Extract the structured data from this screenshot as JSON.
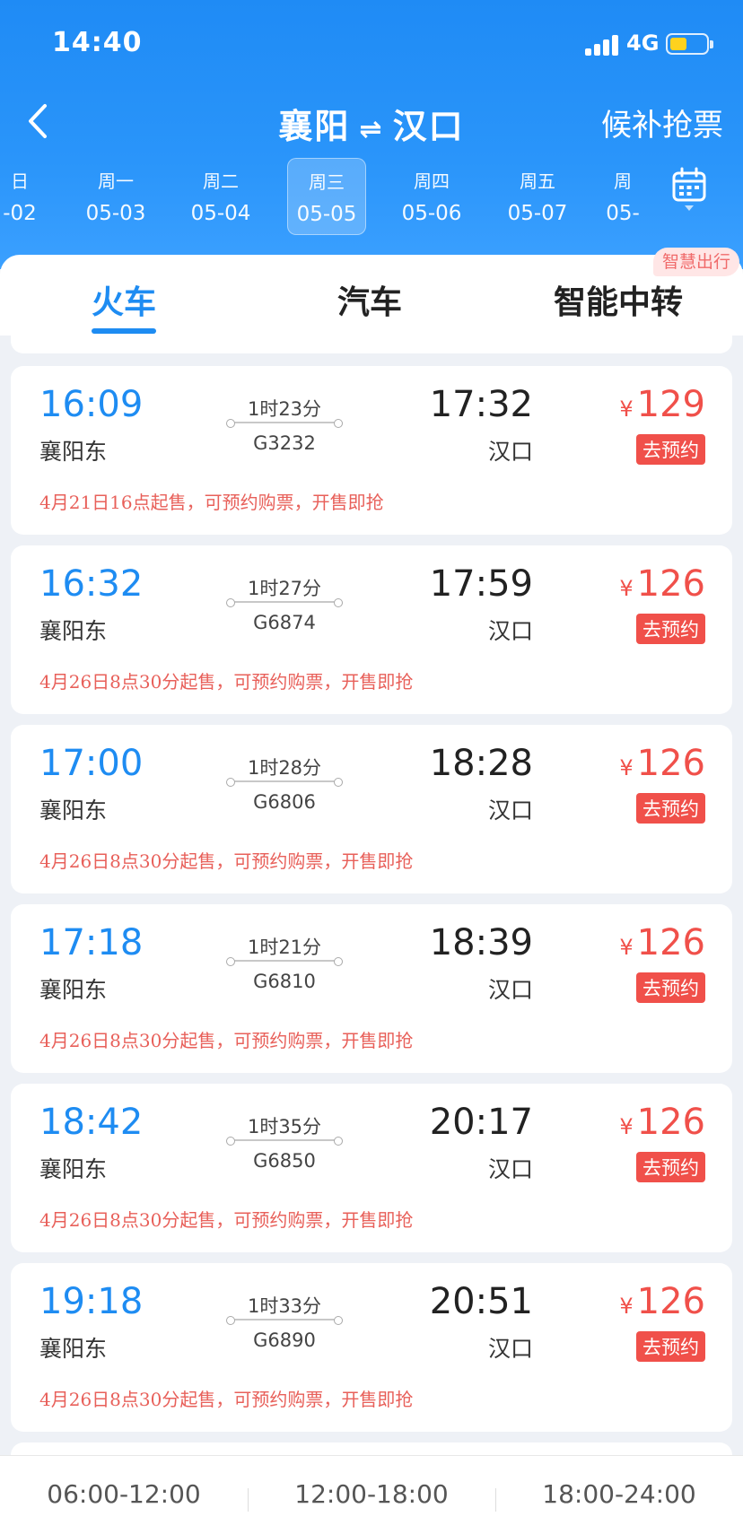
{
  "status_bar": {
    "time": "14:40",
    "network": "4G",
    "battery_fill": 0.45,
    "battery_color": "#ffd21e"
  },
  "nav": {
    "from": "襄阳",
    "swap_symbol": "⇌",
    "to": "汉口",
    "waitlist": "候补抢票"
  },
  "date_strip": [
    {
      "dow": "日",
      "md": "-02",
      "active": false
    },
    {
      "dow": "周一",
      "md": "05-03",
      "active": false
    },
    {
      "dow": "周二",
      "md": "05-04",
      "active": false
    },
    {
      "dow": "周三",
      "md": "05-05",
      "active": true
    },
    {
      "dow": "周四",
      "md": "05-06",
      "active": false
    },
    {
      "dow": "周五",
      "md": "05-07",
      "active": false
    },
    {
      "dow": "周",
      "md": "05-",
      "active": false
    }
  ],
  "mode_tabs": {
    "train": "火车",
    "bus": "汽车",
    "transfer": "智能中转",
    "badge": "智慧出行"
  },
  "trains": [
    {
      "dep_time": "16:09",
      "dep_station": "襄阳东",
      "duration": "1时23分",
      "train_no": "G3232",
      "arr_time": "17:32",
      "arr_station": "汉口",
      "yen": "¥",
      "price": "129",
      "action": "去预约",
      "note": "4月21日16点起售，可预约购票，开售即抢"
    },
    {
      "dep_time": "16:32",
      "dep_station": "襄阳东",
      "duration": "1时27分",
      "train_no": "G6874",
      "arr_time": "17:59",
      "arr_station": "汉口",
      "yen": "¥",
      "price": "126",
      "action": "去预约",
      "note": "4月26日8点30分起售，可预约购票，开售即抢"
    },
    {
      "dep_time": "17:00",
      "dep_station": "襄阳东",
      "duration": "1时28分",
      "train_no": "G6806",
      "arr_time": "18:28",
      "arr_station": "汉口",
      "yen": "¥",
      "price": "126",
      "action": "去预约",
      "note": "4月26日8点30分起售，可预约购票，开售即抢"
    },
    {
      "dep_time": "17:18",
      "dep_station": "襄阳东",
      "duration": "1时21分",
      "train_no": "G6810",
      "arr_time": "18:39",
      "arr_station": "汉口",
      "yen": "¥",
      "price": "126",
      "action": "去预约",
      "note": "4月26日8点30分起售，可预约购票，开售即抢"
    },
    {
      "dep_time": "18:42",
      "dep_station": "襄阳东",
      "duration": "1时35分",
      "train_no": "G6850",
      "arr_time": "20:17",
      "arr_station": "汉口",
      "yen": "¥",
      "price": "126",
      "action": "去预约",
      "note": "4月26日8点30分起售，可预约购票，开售即抢"
    },
    {
      "dep_time": "19:18",
      "dep_station": "襄阳东",
      "duration": "1时33分",
      "train_no": "G6890",
      "arr_time": "20:51",
      "arr_station": "汉口",
      "yen": "¥",
      "price": "126",
      "action": "去预约",
      "note": "4月26日8点30分起售，可预约购票，开售即抢"
    }
  ],
  "time_filter": [
    "06:00-12:00",
    "12:00-18:00",
    "18:00-24:00"
  ],
  "colors": {
    "brand_blue": "#1e8cf2",
    "price_red": "#f0504a",
    "note_red": "#e8605a"
  }
}
